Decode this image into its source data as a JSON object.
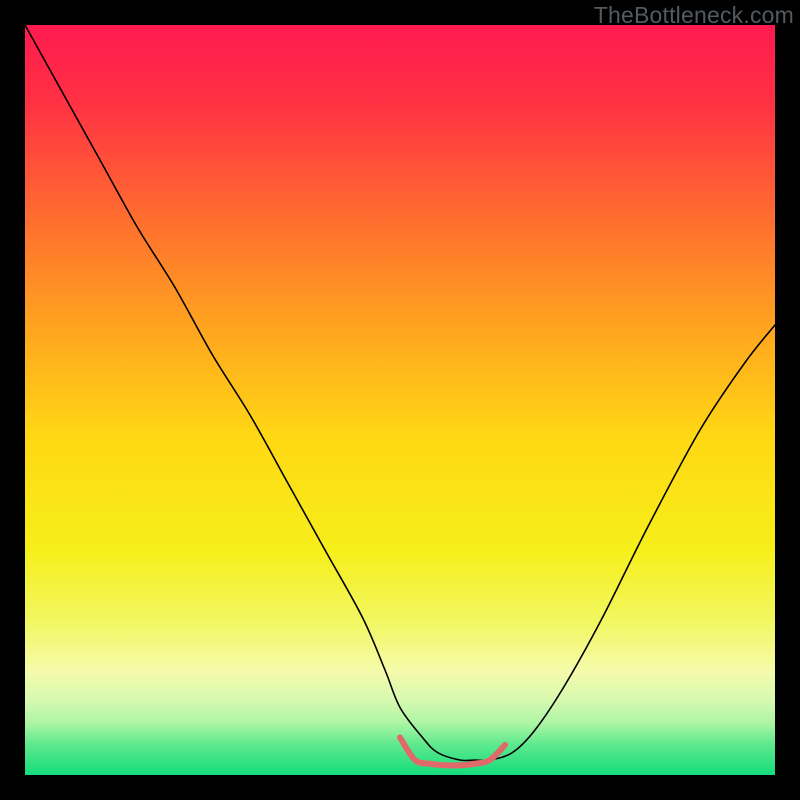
{
  "watermark": "TheBottleneck.com",
  "chart_data": {
    "type": "line",
    "title": "",
    "xlabel": "",
    "ylabel": "",
    "xlim": [
      0,
      100
    ],
    "ylim": [
      0,
      100
    ],
    "grid": false,
    "legend": false,
    "background_gradient": [
      {
        "stop": 0.0,
        "color": "#ff1a4f"
      },
      {
        "stop": 0.1,
        "color": "#ff3044"
      },
      {
        "stop": 0.25,
        "color": "#ff6a30"
      },
      {
        "stop": 0.4,
        "color": "#ffa31f"
      },
      {
        "stop": 0.55,
        "color": "#ffd814"
      },
      {
        "stop": 0.7,
        "color": "#f6ef1a"
      },
      {
        "stop": 0.8,
        "color": "#f2f765"
      },
      {
        "stop": 0.86,
        "color": "#f6fbaa"
      },
      {
        "stop": 0.9,
        "color": "#d6f9b0"
      },
      {
        "stop": 0.93,
        "color": "#aef5a4"
      },
      {
        "stop": 0.96,
        "color": "#5de98d"
      },
      {
        "stop": 1.0,
        "color": "#13dc7c"
      }
    ],
    "series": [
      {
        "name": "bottleneck-curve",
        "color": "#000000",
        "width": 1.6,
        "x": [
          0,
          5,
          10,
          15,
          20,
          25,
          30,
          35,
          40,
          45,
          48,
          50,
          53,
          55,
          58,
          60,
          62,
          65,
          68,
          72,
          77,
          83,
          90,
          96,
          100
        ],
        "y": [
          100,
          91,
          82,
          73,
          65,
          56,
          48,
          39,
          30,
          21,
          14,
          9,
          5,
          3,
          2,
          2,
          2,
          3,
          6,
          12,
          21,
          33,
          46,
          55,
          60
        ]
      },
      {
        "name": "min-marker",
        "color": "#e06a6a",
        "width": 6,
        "x": [
          50,
          52,
          54,
          56,
          58,
          60,
          62,
          64
        ],
        "y": [
          5,
          2,
          1.5,
          1.3,
          1.3,
          1.5,
          2,
          4
        ]
      }
    ]
  }
}
